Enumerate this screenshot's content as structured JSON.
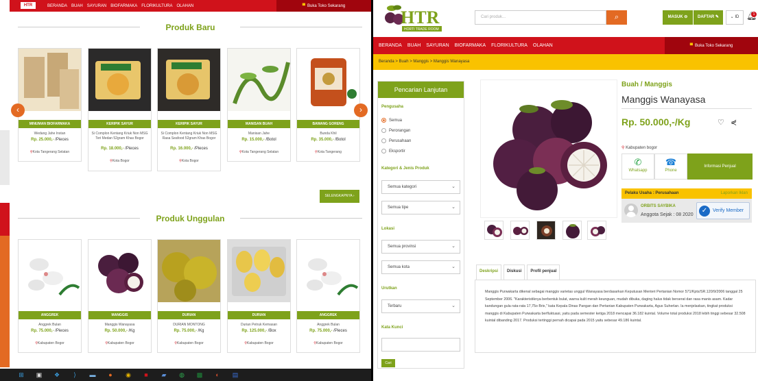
{
  "left_page": {
    "logo_text": "HTR",
    "menu": [
      "BERANDA",
      "BUAH",
      "SAYURAN",
      "BIOFARMAKA",
      "FLORIKULTURA",
      "OLAHAN"
    ],
    "shop_label": "Buka Toko Sekarang",
    "section1_title": "Produk Baru",
    "section2_title": "Produk Unggulan",
    "more_label": "SELENGKAPNYA",
    "new_products": [
      {
        "category": "MINUMAN BIOFARMAKA",
        "name": "Wedang Jahe Instan",
        "price": "Rp. 25.000,-",
        "unit": "/Pieces",
        "location": "Kota Tangerang Selatan"
      },
      {
        "category": "KERIPIK SAYUR",
        "name": "Si Complon Kentang Kriuk Non MSG Teri Medan 52gram Khas Bogor",
        "price": "Rp. 18.000,-",
        "unit": "/Pieces",
        "location": "Kota Bogor"
      },
      {
        "category": "KERIPIK SAYUR",
        "name": "Si Complon Kentang Kriuk Non MSG Rasa Seafood 52gram Khas Bogor",
        "price": "Rp. 16.000,-",
        "unit": "/Pieces",
        "location": "Kota Bogor"
      },
      {
        "category": "MANISAN BUAH",
        "name": "Manisan Jahe",
        "price": "Rp. 15.000,-",
        "unit": "/Botol",
        "location": "Kota Tangerang Selatan"
      },
      {
        "category": "BAWANG GORENG",
        "name": "Bunda Khil",
        "price": "Rp. 35.000,-",
        "unit": "/Botol",
        "location": "Kota Tangerang"
      }
    ],
    "featured_products": [
      {
        "category": "ANGGREK",
        "name": "Anggrek Bulan",
        "price": "Rp. 75.000,-",
        "unit": "/Pieces",
        "location": "Kabupaten Bogor"
      },
      {
        "category": "MANGGIS",
        "name": "Manggis Wanayasa",
        "price": "Rp. 50.000,-",
        "unit": "/Kg",
        "location": "Kabupaten Bogor"
      },
      {
        "category": "DURIAN",
        "name": "DURIAN MONTONG",
        "price": "Rp. 75.000,-",
        "unit": "/Kg",
        "location": "Kabupaten Bogor"
      },
      {
        "category": "DURIAN",
        "name": "Durian Petruk Kemasan",
        "price": "Rp. 125.000,-",
        "unit": "/Box",
        "location": "Kabupaten Bogor"
      },
      {
        "category": "ANGGREK",
        "name": "Anggrek Bulan",
        "price": "Rp. 75.000,-",
        "unit": "/Pieces",
        "location": "Kabupaten Bogor"
      }
    ]
  },
  "right_page": {
    "logo_text": "HTR",
    "logo_sub": "HORTI TRADE ROOM",
    "search_placeholder": "Cari produk...",
    "login_label": "MASUK",
    "register_label": "DAFTAR",
    "lang_label": "ID",
    "bell_count": "1",
    "menu": [
      "BERANDA",
      "BUAH",
      "SAYURAN",
      "BIOFARMAKA",
      "FLORIKULTURA",
      "OLAHAN"
    ],
    "shop_label": "Buka Toko Sekarang",
    "breadcrumb": "Beranda > Buah > Manggis > Manggis Wanayasa",
    "filter": {
      "title": "Pencarian Lanjutan",
      "pengusaha_label": "Pengusaha",
      "pengusaha_options": [
        "Semua",
        "Perorangan",
        "Perusahaan",
        "Eksportir"
      ],
      "kategori_label": "Kategori & Jenis Produk",
      "kategori_select": "Semua kategori",
      "tipe_select": "Semua tipe",
      "lokasi_label": "Lokasi",
      "provinsi_select": "Semua provinsi",
      "kota_select": "Semua kota",
      "urutkan_label": "Urutkan",
      "urutkan_select": "Terbaru",
      "kata_label": "Kata Kunci",
      "cari_label": "Cari"
    },
    "product": {
      "category": "Buah / Manggis",
      "title": "Manggis Wanayasa",
      "price": "Rp. 50.000,-/Kg",
      "location": "Kabupaten bogor",
      "whatsapp_label": "Whatsapp",
      "phone_label": "Phone",
      "info_label": "Informasi Penjual",
      "seller_type_label": "Pelaku Usaha : Perusahaan",
      "report_label": "Laporkan Iklan",
      "seller_name": "ORBITS SAYBIKA",
      "seller_since": "Anggota Sejak : 08 2020",
      "verify_label": "Verify Member"
    },
    "tabs": [
      "Deskripsi",
      "Diskusi",
      "Profil penjual"
    ],
    "description": "Manggis Purwakarta dikenal sebagai manggis varietas unggul Wanayasa berdasarkan Keputusan Menteri Pertanian Nomor 571/Kpts/SR.120/9/2006 tanggal 25 September 2006. \"Karakteristiknya berbentuk bulat, warna kulit merah keunguan, mudah dibuka, daging halus tidak berserat dan rasa manis asam. Kadar kandungan gula rata-rata 17,75o Brix,\" kata Kepala Dinas Pangan dan Pertanian Kabupaten Purwakarta, Agus Suherlan. Ia menjelaskan, tingkat produksi manggis di Kabupaten Purwakarta berfluktuasi, yaitu pada semester ketiga 2018 mencapai 36.182 kuintal. Volume total produksi 2018 lebih tinggi sebesar 32.508 kuintal dibanding 2017. Produksi tertinggi pernah dicapai pada 2015 yaitu sebesar 49.186 kuintal."
  },
  "colors": {
    "red": "#d0121b",
    "dark_red": "#a0050d",
    "green": "#7ea21b",
    "orange": "#e36a23",
    "yellow": "#f9c200"
  }
}
